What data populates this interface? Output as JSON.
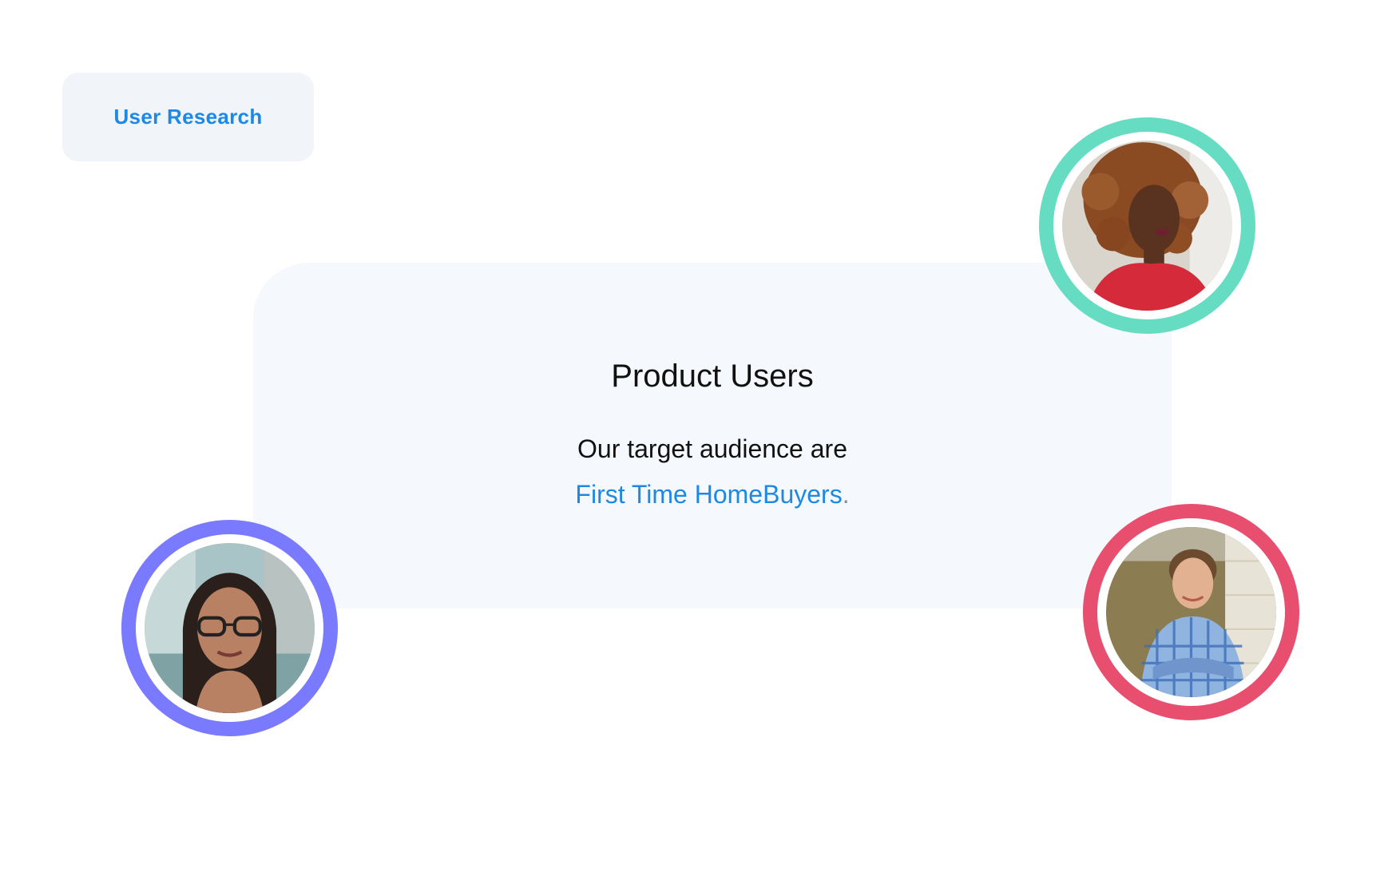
{
  "section_tag": {
    "label": "User Research"
  },
  "card": {
    "title": "Product Users",
    "line1": "Our target audience are",
    "highlight": "First Time HomeBuyers",
    "trailing": "."
  },
  "avatars": [
    {
      "name": "user-avatar-1",
      "ring_color": "#66dcc3"
    },
    {
      "name": "user-avatar-2",
      "ring_color": "#7a7aff"
    },
    {
      "name": "user-avatar-3",
      "ring_color": "#e84f6f"
    }
  ],
  "colors": {
    "accent": "#1e88e5",
    "tag_bg": "#f1f4f8",
    "card_bg": "#f5f8fc"
  }
}
